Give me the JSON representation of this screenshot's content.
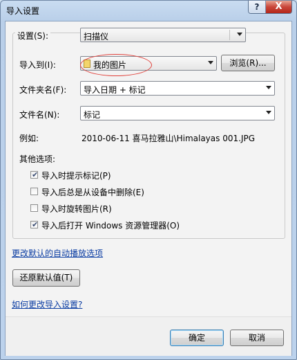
{
  "window": {
    "title": "导入设置",
    "help_glyph": "?",
    "close_glyph": "X"
  },
  "settings": {
    "label": "设置(S):",
    "value": "扫描仪"
  },
  "import_to": {
    "label": "导入到(I):",
    "value": "我的图片",
    "browse_label": "浏览(R)..."
  },
  "folder_name": {
    "label": "文件夹名(F):",
    "value": "导入日期 + 标记"
  },
  "file_name": {
    "label": "文件名(N):",
    "value": "标记"
  },
  "example": {
    "label": "例如:",
    "value": "2010-06-11 喜马拉雅山\\Himalayas 001.JPG"
  },
  "other_options": {
    "label": "其他选项:",
    "items": [
      {
        "label": "导入时提示标记(P)",
        "checked": true
      },
      {
        "label": "导入后总是从设备中删除(E)",
        "checked": false
      },
      {
        "label": "导入时旋转图片(R)",
        "checked": false
      },
      {
        "label": "导入后打开 Windows 资源管理器(O)",
        "checked": true
      }
    ]
  },
  "links": {
    "autoplay": "更改默认的自动播放选项",
    "howto": "如何更改导入设置?"
  },
  "restore_label": "还原默认值(T)",
  "ok_label": "确定",
  "cancel_label": "取消",
  "check_glyph": "✔",
  "colors": {
    "annotation": "#e0403a",
    "link": "#0b3da3"
  }
}
